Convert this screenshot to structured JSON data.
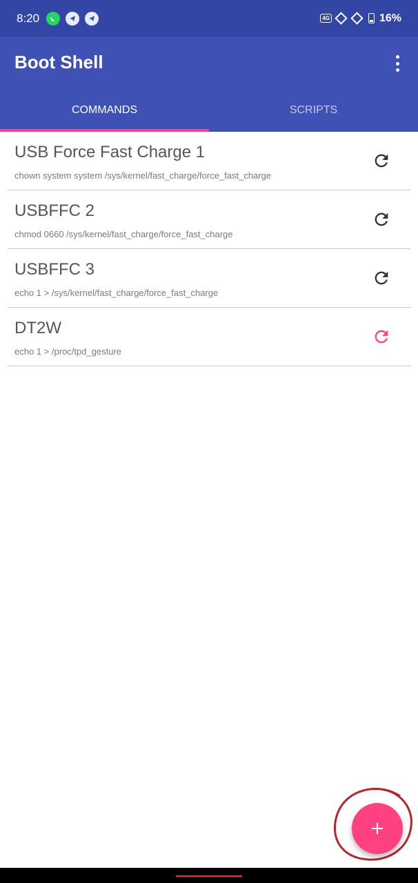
{
  "status_bar": {
    "time": "8:20",
    "network_badge": "4G",
    "battery_percent": "16%"
  },
  "app_bar": {
    "title": "Boot Shell",
    "menu_icon": "more-vert-icon"
  },
  "tabs": [
    {
      "label": "COMMANDS",
      "active": true
    },
    {
      "label": "SCRIPTS",
      "active": false
    }
  ],
  "commands": [
    {
      "name": "USB Force Fast Charge 1",
      "code": "chown system system /sys/kernel/fast_charge/force_fast_charge",
      "icon_color": "#333333"
    },
    {
      "name": "USBFFC 2",
      "code": "chmod 0660 /sys/kernel/fast_charge/force_fast_charge",
      "icon_color": "#333333"
    },
    {
      "name": "USBFFC 3",
      "code": "echo 1 > /sys/kernel/fast_charge/force_fast_charge",
      "icon_color": "#333333"
    },
    {
      "name": "DT2W",
      "code": "echo 1 > /proc/tpd_gesture",
      "icon_color": "#ff4081"
    }
  ],
  "fab": {
    "icon": "plus-icon"
  },
  "colors": {
    "primary": "#3f51b5",
    "primary_dark": "#3346a6",
    "accent": "#ff4081"
  }
}
